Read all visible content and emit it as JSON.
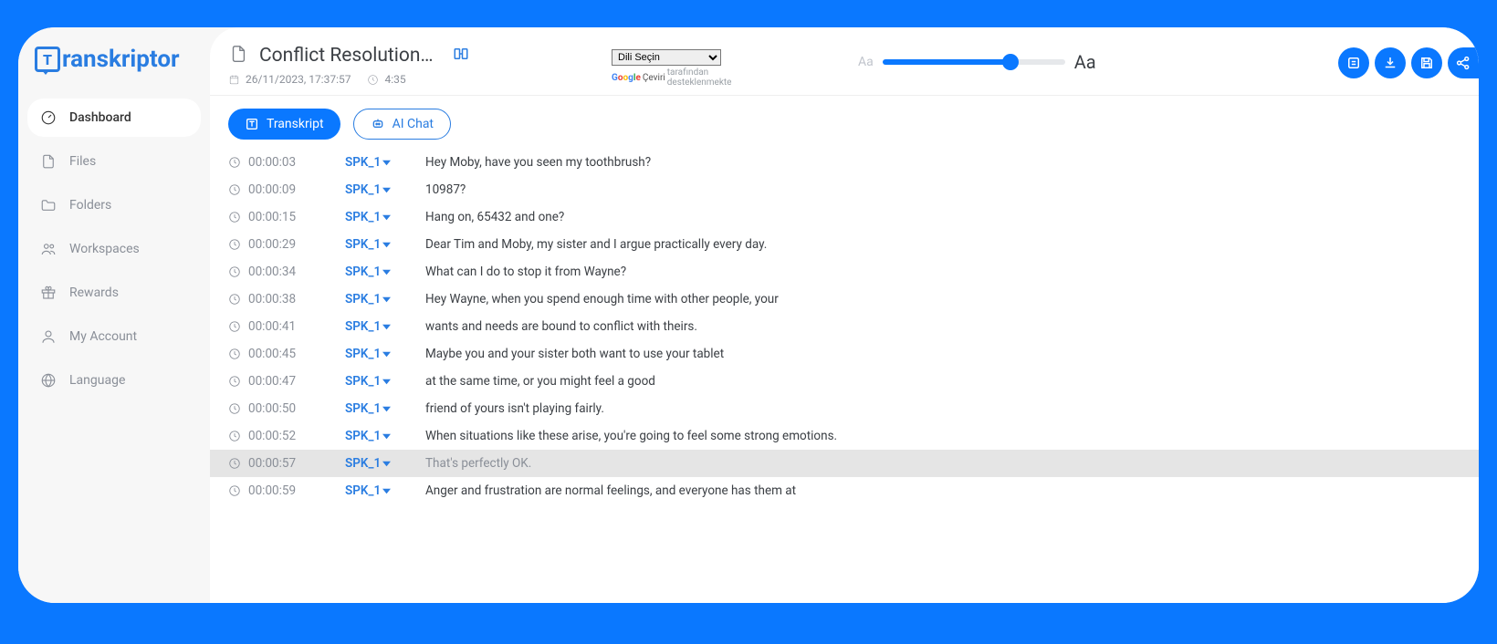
{
  "brand": "ranskriptor",
  "brand_letter": "T",
  "nav": {
    "dashboard": "Dashboard",
    "files": "Files",
    "folders": "Folders",
    "workspaces": "Workspaces",
    "rewards": "Rewards",
    "my_account": "My Account",
    "language": "Language"
  },
  "header": {
    "title": "Conflict Resolution_ Ho...",
    "date": "26/11/2023, 17:37:57",
    "duration": "4:35"
  },
  "language_selector": {
    "selected": "Dili Seçin",
    "powered_by_word": "Çeviri",
    "powered_by_tail": "tarafından desteklenmekte"
  },
  "font_slider": {
    "small_label": "Aa",
    "large_label": "Aa",
    "value": 70
  },
  "tabs": {
    "transkript": "Transkript",
    "ai_chat": "AI Chat"
  },
  "transcript": [
    {
      "time": "00:00:03",
      "speaker": "SPK_1",
      "text": "Hey Moby, have you seen my toothbrush?",
      "highlight": false
    },
    {
      "time": "00:00:09",
      "speaker": "SPK_1",
      "text": "10987?",
      "highlight": false
    },
    {
      "time": "00:00:15",
      "speaker": "SPK_1",
      "text": "Hang on, 65432 and one?",
      "highlight": false
    },
    {
      "time": "00:00:29",
      "speaker": "SPK_1",
      "text": "Dear Tim and Moby, my sister and I argue practically every day.",
      "highlight": false
    },
    {
      "time": "00:00:34",
      "speaker": "SPK_1",
      "text": "What can I do to stop it from Wayne?",
      "highlight": false
    },
    {
      "time": "00:00:38",
      "speaker": "SPK_1",
      "text": "Hey Wayne, when you spend enough time with other people, your",
      "highlight": false
    },
    {
      "time": "00:00:41",
      "speaker": "SPK_1",
      "text": "wants and needs are bound to conflict with theirs.",
      "highlight": false
    },
    {
      "time": "00:00:45",
      "speaker": "SPK_1",
      "text": "Maybe you and your sister both want to use your tablet",
      "highlight": false
    },
    {
      "time": "00:00:47",
      "speaker": "SPK_1",
      "text": "at the same time, or you might feel a good",
      "highlight": false
    },
    {
      "time": "00:00:50",
      "speaker": "SPK_1",
      "text": "friend of yours isn't playing fairly.",
      "highlight": false
    },
    {
      "time": "00:00:52",
      "speaker": "SPK_1",
      "text": "When situations like these arise, you're going to feel some strong emotions.",
      "highlight": false
    },
    {
      "time": "00:00:57",
      "speaker": "SPK_1",
      "text": "That's perfectly OK.",
      "highlight": true
    },
    {
      "time": "00:00:59",
      "speaker": "SPK_1",
      "text": "Anger and frustration are normal feelings, and everyone has them at",
      "highlight": false
    }
  ]
}
